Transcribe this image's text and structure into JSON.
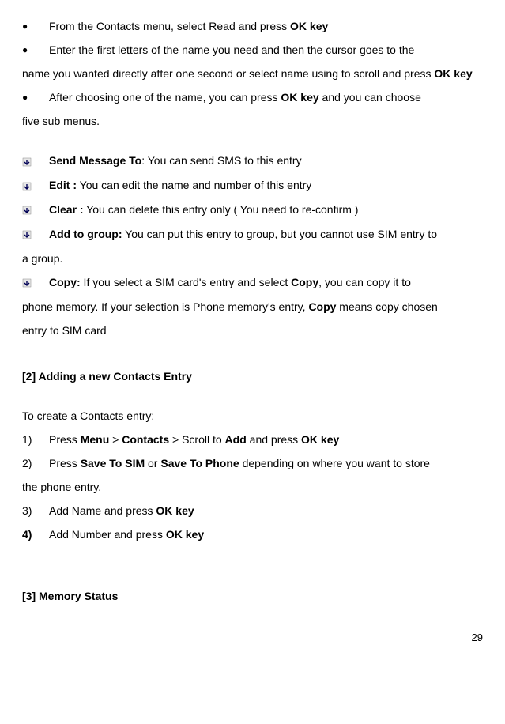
{
  "bullets": {
    "b1_pre": "From the Contacts menu, select Read and press ",
    "b1_bold": "OK key",
    "b2_pre": "Enter the first letters of the name you need and then the cursor goes to the",
    "b2_cont_pre": "name you wanted directly after one second or select name using to scroll and press ",
    "b2_cont_bold": "OK key",
    "b3_pre": "After choosing one of the name, you can press ",
    "b3_bold": "OK key",
    "b3_post": " and you can choose",
    "b3_cont": "five sub menus."
  },
  "submenus": {
    "send_label": "Send Message To",
    "send_desc": ": You can send SMS to this entry",
    "edit_label": "Edit :",
    "edit_desc": " You can edit the name and number of this entry",
    "clear_label": "Clear :",
    "clear_desc": " You can delete this entry only ( You need to re-confirm )",
    "add_label": "Add to group:",
    "add_desc": " You can put this entry to group, but you cannot use SIM entry to",
    "add_cont": "a group.",
    "copy_label": "Copy:",
    "copy_desc_pre": " If you select a SIM card's entry and select ",
    "copy_desc_bold": "Copy",
    "copy_desc_post": ", you can copy it to",
    "copy_cont_pre": "phone memory. If your selection is Phone memory's entry, ",
    "copy_cont_bold": "Copy",
    "copy_cont_post": " means copy chosen",
    "copy_cont2": "entry to SIM card"
  },
  "section2": {
    "heading": "[2]    Adding a new Contacts Entry",
    "intro": "To create a Contacts entry:",
    "s1_num": "1)",
    "s1_pre": "Press ",
    "s1_b1": "Menu",
    "s1_mid1": " > ",
    "s1_b2": "Contacts",
    "s1_mid2": " > Scroll to ",
    "s1_b3": "Add",
    "s1_mid3": " and press ",
    "s1_b4": "OK key",
    "s2_num": "2)",
    "s2_pre": "Press ",
    "s2_b1": "Save To SIM",
    "s2_mid": " or ",
    "s2_b2": "Save To Phone",
    "s2_post": " depending on where you want to store",
    "s2_cont": "the phone entry.",
    "s3_num": "3)",
    "s3_pre": "Add Name and press ",
    "s3_bold": "OK key",
    "s4_num": "4)",
    "s4_pre": "Add Number and press ",
    "s4_bold": "OK key"
  },
  "section3": {
    "heading": "[3]    Memory Status"
  },
  "page_number": "29"
}
